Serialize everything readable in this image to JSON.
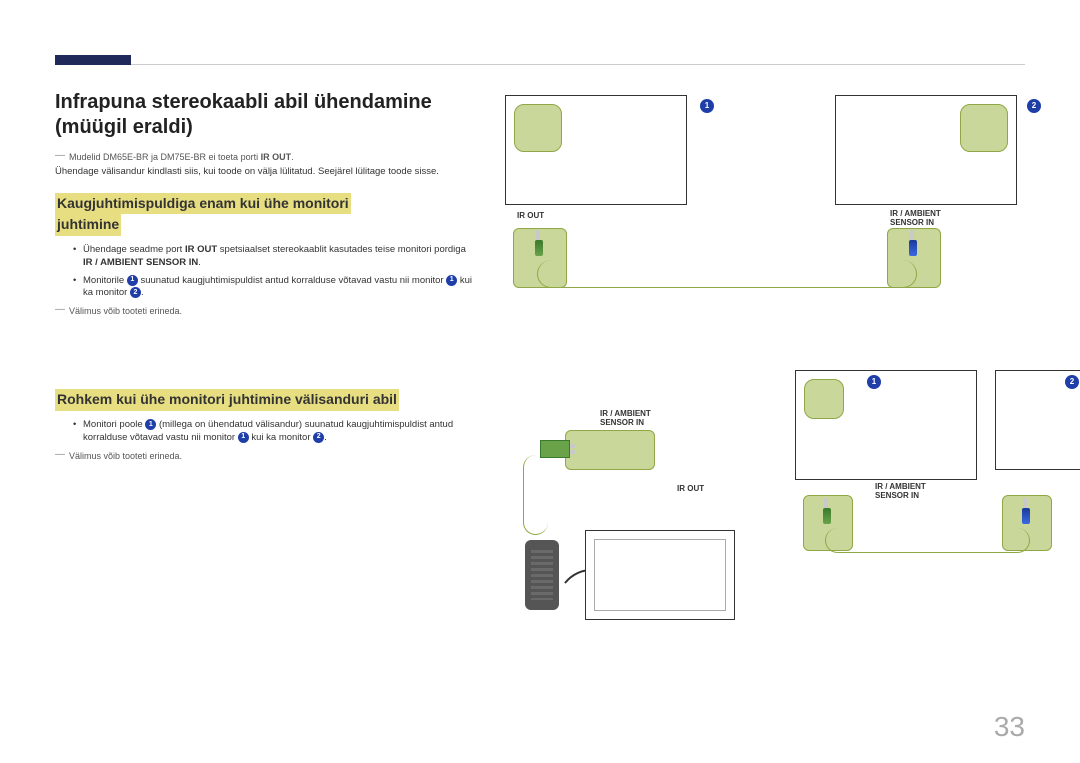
{
  "title": "Infrapuna stereokaabli abil ühendamine (müügil eraldi)",
  "note_models": "Mudelid DM65E-BR ja DM75E-BR ei toeta porti",
  "note_models_b": "IR OUT",
  "note_models_suffix": ".",
  "intro_para": "Ühendage välisandur kindlasti siis, kui toode on välja lülitatud. Seejärel lülitage toode sisse.",
  "section1_h_l1": "Kaugjuhtimispuldiga enam kui ühe monitori",
  "section1_h_l2": "juhtimine",
  "s1_b1_pre": "Ühendage seadme port",
  "s1_b1_b1": "IR OUT",
  "s1_b1_mid": "spetsiaalset stereokaablit kasutades teise monitori pordiga",
  "s1_b1_b2": "IR / AMBIENT SENSOR IN",
  "s1_b2_pre": "Monitorile",
  "s1_b2_mid": "suunatud kaugjuhtimispuldist antud korralduse võtavad vastu nii monitor",
  "s1_b2_mid2": "kui ka monitor",
  "note_var": "Välimus võib tooteti erineda.",
  "section2_h": "Rohkem kui ühe monitori juhtimine välisanduri abil",
  "s2_b1_pre": "Monitori poole",
  "s2_b1_mid": "(millega on ühendatud välisandur) suunatud kaugjuhtimispuldist antud korralduse võtavad vastu nii monitor",
  "s2_b1_mid2": "kui ka monitor",
  "lbl_irout": "IR OUT",
  "lbl_irin_l1": "IR / AMBIENT",
  "lbl_irin_l2": "SENSOR IN",
  "n1": "1",
  "n2": "2",
  "dot": ".",
  "page_num": "33"
}
